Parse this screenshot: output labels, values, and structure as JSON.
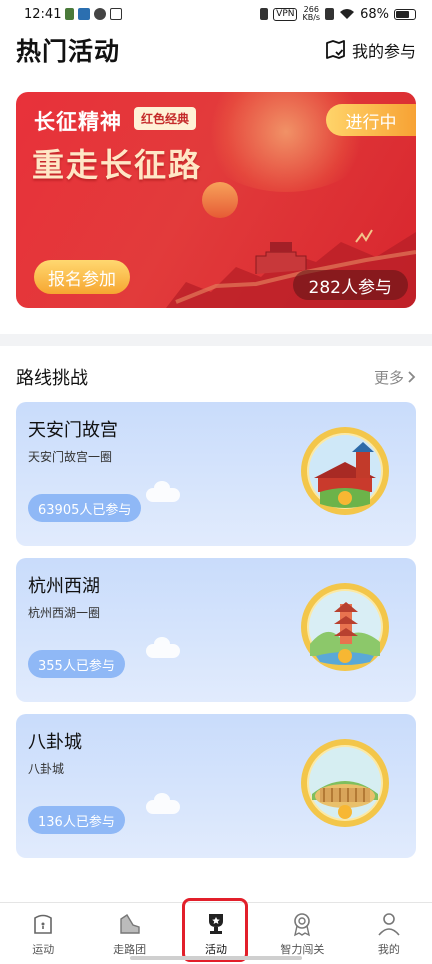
{
  "status_bar": {
    "time": "12:41",
    "vpn": "VPN",
    "speed_value": "266",
    "speed_unit": "KB/s",
    "battery": "68%"
  },
  "header": {
    "title": "热门活动",
    "my_join": "我的参与"
  },
  "banner": {
    "subtitle": "长征精神",
    "tag": "红色经典",
    "title": "重走长征路",
    "status": "进行中",
    "join_button": "报名参加",
    "participants": "282人参与"
  },
  "section": {
    "title": "路线挑战",
    "more": "更多"
  },
  "routes": [
    {
      "title": "天安门故宫",
      "desc": "天安门故宫一圈",
      "count": "63905人已参与",
      "icon": "tiananmen-medal-icon"
    },
    {
      "title": "杭州西湖",
      "desc": "杭州西湖一圈",
      "count": "355人已参与",
      "icon": "pagoda-medal-icon"
    },
    {
      "title": "八卦城",
      "desc": "八卦城",
      "count": "136人已参与",
      "icon": "bagua-city-medal-icon"
    }
  ],
  "nav": {
    "items": [
      {
        "label": "运动",
        "icon": "sport-icon"
      },
      {
        "label": "走路团",
        "icon": "shoe-icon"
      },
      {
        "label": "活动",
        "icon": "trophy-icon"
      },
      {
        "label": "智力闯关",
        "icon": "medal-ribbon-icon"
      },
      {
        "label": "我的",
        "icon": "user-icon"
      }
    ],
    "active_index": 2
  },
  "colors": {
    "banner_red": "#e23b3b",
    "accent_orange": "#f6a631",
    "card_blue": "#c9dcfb",
    "highlight_red": "#e21f2a"
  }
}
